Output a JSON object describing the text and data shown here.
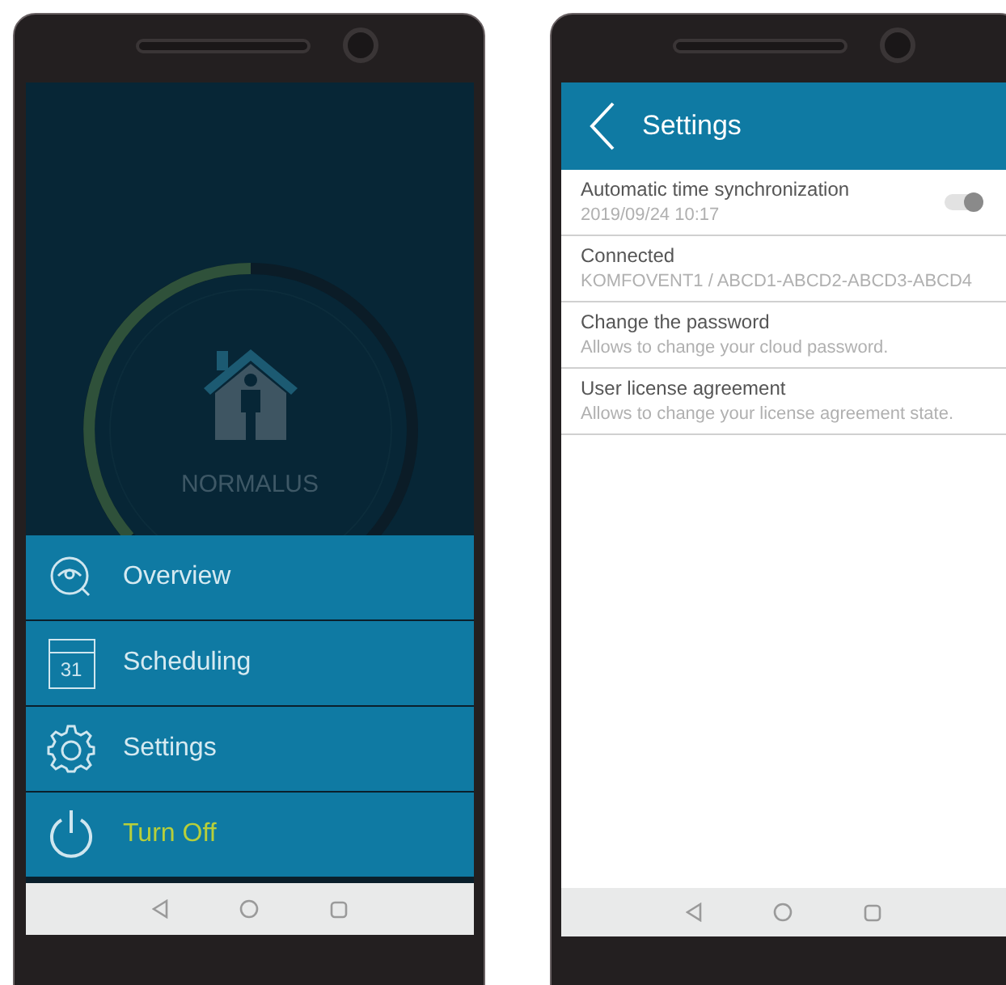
{
  "main_screen": {
    "mode_label": "NORMALUS",
    "menu": [
      {
        "kind": "overview",
        "label": "Overview"
      },
      {
        "kind": "calendar",
        "label": "Scheduling",
        "icon_text": "31"
      },
      {
        "kind": "settings",
        "label": "Settings"
      },
      {
        "kind": "power",
        "label": "Turn Off"
      }
    ]
  },
  "settings_screen": {
    "title": "Settings",
    "rows": [
      {
        "kind": "toggle",
        "title": "Automatic time synchronization",
        "subtitle": "2019/09/24 10:17",
        "on": true
      },
      {
        "kind": "info",
        "title": "Connected",
        "subtitle": "KOMFOVENT1 / ABCD1-ABCD2-ABCD3-ABCD4"
      },
      {
        "kind": "info",
        "title": "Change the password",
        "subtitle": "Allows to change your cloud password."
      },
      {
        "kind": "info",
        "title": "User license agreement",
        "subtitle": "Allows to change your license agreement state."
      }
    ]
  }
}
